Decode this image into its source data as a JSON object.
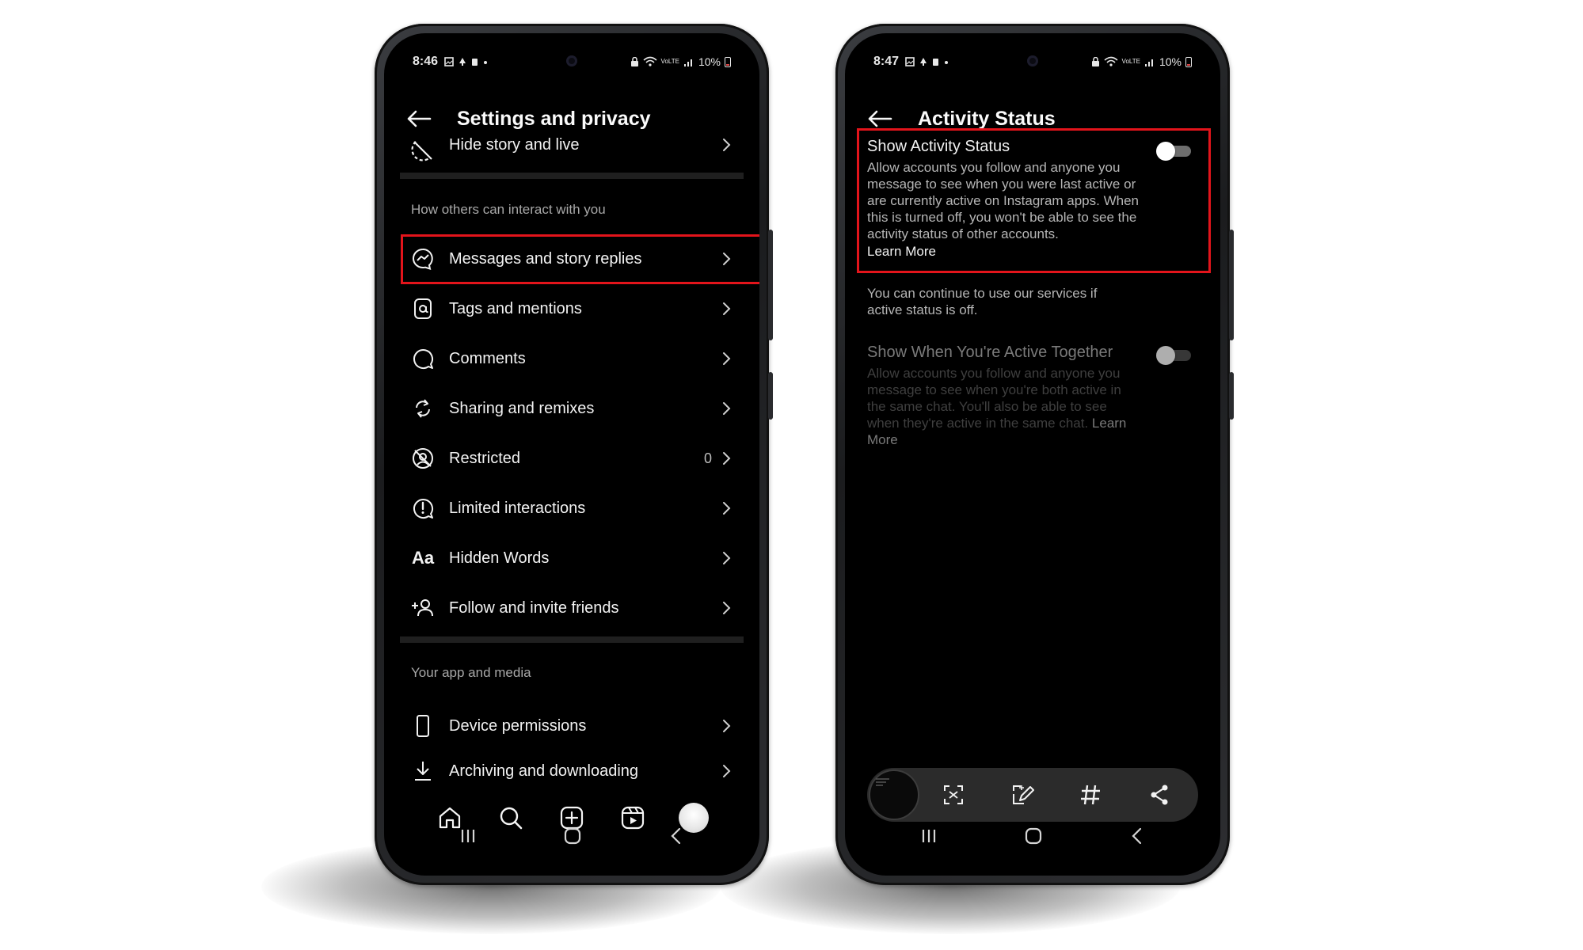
{
  "left_phone": {
    "statusbar": {
      "time": "8:46",
      "battery": "10%",
      "signal_label": "VoLTE"
    },
    "header": {
      "title": "Settings and privacy"
    },
    "top_row": {
      "label": "Hide story and live"
    },
    "section_interact": {
      "label": "How others can interact with you"
    },
    "items": [
      {
        "label": "Messages and story replies",
        "icon": "messenger-icon"
      },
      {
        "label": "Tags and mentions",
        "icon": "at-sign-icon"
      },
      {
        "label": "Comments",
        "icon": "comment-icon"
      },
      {
        "label": "Sharing and remixes",
        "icon": "refresh-icon"
      },
      {
        "label": "Restricted",
        "icon": "restricted-icon",
        "count": "0"
      },
      {
        "label": "Limited interactions",
        "icon": "alert-icon"
      },
      {
        "label": "Hidden Words",
        "icon": "text-icon",
        "icon_text": "Aa"
      },
      {
        "label": "Follow and invite friends",
        "icon": "add-person-icon"
      }
    ],
    "section_app": {
      "label": "Your app and media"
    },
    "app_items": [
      {
        "label": "Device permissions",
        "icon": "phone-icon"
      },
      {
        "label": "Archiving and downloading",
        "icon": "download-icon"
      }
    ],
    "nav": [
      "home-icon",
      "search-icon",
      "create-icon",
      "reels-icon",
      "profile-avatar"
    ]
  },
  "right_phone": {
    "statusbar": {
      "time": "8:47",
      "battery": "10%",
      "signal_label": "VoLTE"
    },
    "header": {
      "title": "Activity Status"
    },
    "show_activity": {
      "title": "Show Activity Status",
      "desc": "Allow accounts you follow and anyone you message to see when you were last active or are currently active on Instagram apps. When this is turned off, you won't be able to see the activity status of other accounts.",
      "link": "Learn More",
      "enabled": false
    },
    "note": "You can continue to use our services if active status is off.",
    "active_together": {
      "title": "Show When You're Active Together",
      "desc": "Allow accounts you follow and anyone you message to see when you're both active in the same chat. You'll also be able to see when they're active in the same chat.",
      "link_part1": "Learn",
      "link_part2": "More",
      "enabled": false
    },
    "toolbar": [
      "scan-icon",
      "edit-icon",
      "hashtag-icon",
      "share-icon"
    ]
  },
  "colors": {
    "highlight": "#e3141b",
    "screen_bg": "#000000",
    "text_primary": "#f2f2f2",
    "text_secondary": "#a8a8a8"
  }
}
